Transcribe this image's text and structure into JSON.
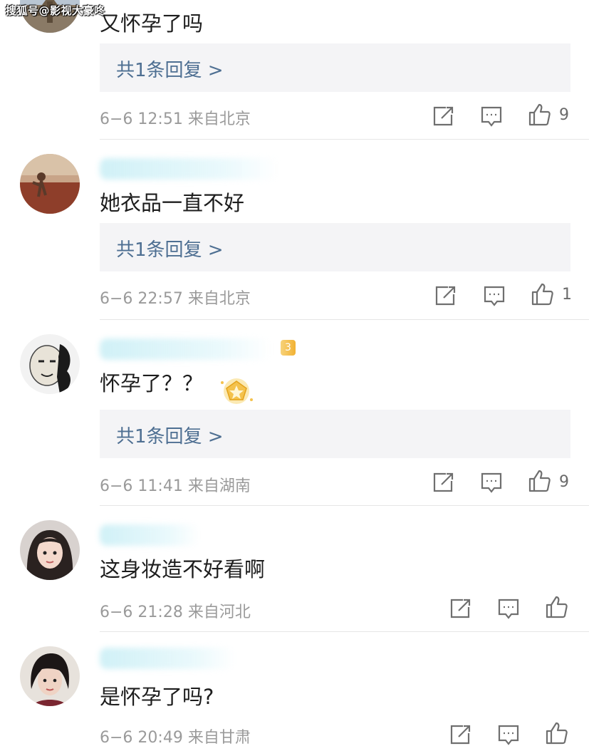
{
  "watermark": "搜狐号@影视大豪咚",
  "comments": [
    {
      "text": "又怀孕了吗",
      "reply": "共1条回复 >",
      "meta": "6−6 12:51 来自北京",
      "likes": "9"
    },
    {
      "text": "她衣品一直不好",
      "reply": "共1条回复 >",
      "meta": "6−6 22:57 来自北京",
      "likes": "1"
    },
    {
      "text": "怀孕了？？",
      "reply": "共1条回复 >",
      "meta": "6−6 11:41 来自湖南",
      "likes": "9",
      "badge": "3"
    },
    {
      "text": "这身妆造不好看啊",
      "meta": "6−6 21:28 来自河北",
      "likes": ""
    },
    {
      "text": "是怀孕了吗?",
      "meta": "6−6 20:49 来自甘肃",
      "likes": ""
    }
  ],
  "icons": {
    "share": "share-icon",
    "comment": "comment-icon",
    "like": "thumbs-up-icon",
    "star": "star-badge-icon"
  },
  "colors": {
    "reply_link": "#4e6f92",
    "meta": "#9a9a9a",
    "reply_bg": "#f4f4f6"
  }
}
